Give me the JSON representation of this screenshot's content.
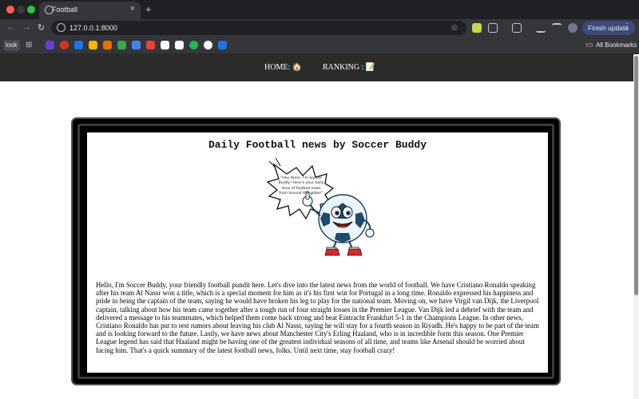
{
  "browser": {
    "tab_title": "Football",
    "tab_close": "×",
    "new_tab": "+",
    "back": "←",
    "forward": "→",
    "reload": "↻",
    "url": "127.0.0.1:8000",
    "star": "☆",
    "finish_update": "Finish update",
    "menu": "⋮",
    "apps": "⊞",
    "bookmark_folder": "look",
    "all_bookmarks_icon": "▭",
    "all_bookmarks": "All Bookmarks"
  },
  "site": {
    "nav": {
      "home": "HOME: 🏠",
      "ranking": "RANKING : 📝"
    },
    "headline": "Daily Football news by Soccer Buddy",
    "bubble": "\"Hey there, I'm Soccer Buddy! Here's your daily dose of football news from around the globe!\"",
    "article": "Hello, I'm Soccer Buddy, your friendly football pundit here. Let's dive into the latest news from the world of football. We have Cristiano Ronaldo speaking after his team Al Nassr won a title, which is a special moment for him as it's his first win for Portugal in a long time. Ronaldo expressed his happiness and pride in being the captain of the team, saying he would have broken his leg to play for the national team. Moving on, we have Virgil van Dijk, the Liverpool captain, talking about how his team came together after a tough run of four straight losses in the Premier League. Van Dijk led a debrief with the team and delivered a message to his teammates, which helped them come back strong and beat Eintracht Frankfurt 5-1 in the Champions League. In other news, Cristiano Ronaldo has put to rest rumors about leaving his club Al Nassr, saying he will stay for a fourth season in Riyadh. He's happy to be part of the team and is looking forward to the future. Lastly, we have news about Manchester City's Erling Haaland, who is in incredible form this season. One Premier League legend has said that Haaland might be having one of the greatest individual seasons of all time, and teams like Arsenal should be worried about facing him. That's a quick summary of the latest football news, folks. Until next time, stay football crazy!"
  },
  "colors": {
    "chrome": "#1f2023",
    "toolbar": "#35363a",
    "site_nav": "#2b2b2b",
    "frame": "#000000"
  }
}
